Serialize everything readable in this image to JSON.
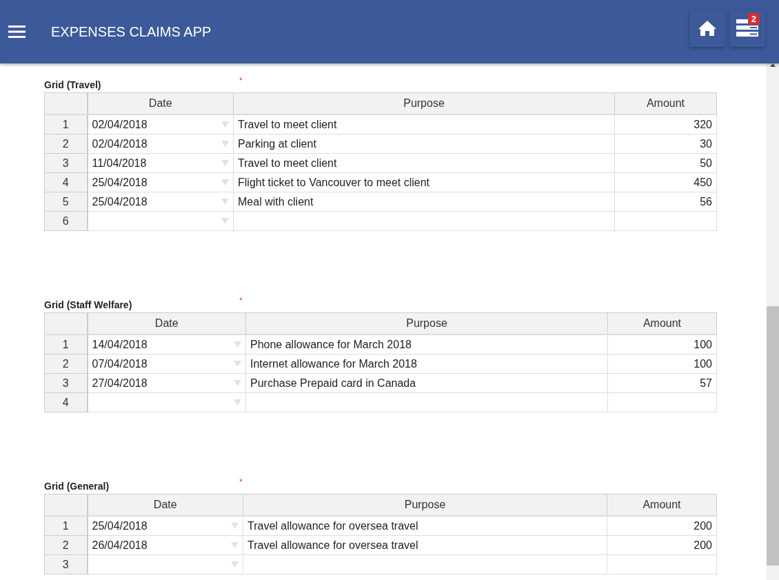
{
  "app_bar": {
    "title": "EXPENSES CLAIMS APP",
    "notification_count": "2"
  },
  "grids": [
    {
      "title": "Grid (Travel)",
      "required_mark": "*",
      "columns": [
        "Date",
        "Purpose",
        "Amount"
      ],
      "rows": [
        {
          "number": "1",
          "date": "02/04/2018",
          "purpose": "Travel to meet client",
          "amount": "320"
        },
        {
          "number": "2",
          "date": "02/04/2018",
          "purpose": "Parking at client",
          "amount": "30"
        },
        {
          "number": "3",
          "date": "11/04/2018",
          "purpose": "Travel to meet client",
          "amount": "50"
        },
        {
          "number": "4",
          "date": "25/04/2018",
          "purpose": "Flight ticket to Vancouver to meet client",
          "amount": "450"
        },
        {
          "number": "5",
          "date": "25/04/2018",
          "purpose": "Meal with client",
          "amount": "56"
        },
        {
          "number": "6"
        }
      ]
    },
    {
      "title": "Grid (Staff Welfare)",
      "required_mark": "*",
      "columns": [
        "Date",
        "Purpose",
        "Amount"
      ],
      "rows": [
        {
          "number": "1",
          "date": "14/04/2018",
          "purpose": "Phone allowance for March 2018",
          "amount": "100"
        },
        {
          "number": "2",
          "date": "07/04/2018",
          "purpose": "Internet allowance for March 2018",
          "amount": "100"
        },
        {
          "number": "3",
          "date": "27/04/2018",
          "purpose": "Purchase Prepaid card in Canada",
          "amount": "57"
        },
        {
          "number": "4"
        }
      ]
    },
    {
      "title": "Grid (General)",
      "required_mark": "*",
      "columns": [
        "Date",
        "Purpose",
        "Amount"
      ],
      "rows": [
        {
          "number": "1",
          "date": "25/04/2018",
          "purpose": "Travel allowance for oversea travel",
          "amount": "200"
        },
        {
          "number": "2",
          "date": "26/04/2018",
          "purpose": "Travel allowance for oversea travel",
          "amount": "200"
        },
        {
          "number": "3"
        }
      ]
    }
  ]
}
